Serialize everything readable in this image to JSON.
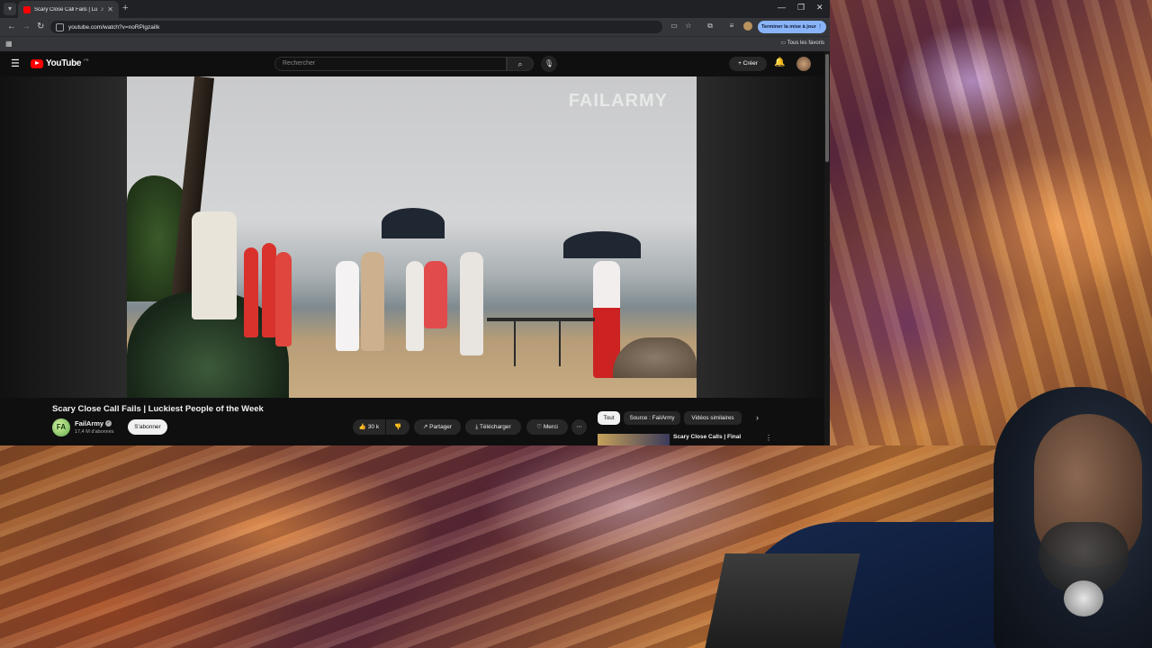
{
  "browser": {
    "tab_title": "Scary Close Call Fails | Lucki",
    "url": "youtube.com/watch?v=noRPigzaiIk",
    "update_button": "Terminer la mise à jour",
    "bookmarks_folder": "Tous les favoris"
  },
  "youtube": {
    "logo_text": "YouTube",
    "logo_sup": "FR",
    "search_placeholder": "Rechercher",
    "create_label": "Créer",
    "watermark": "FAILARMY",
    "video_title": "Scary Close Call Fails | Luckiest People of the Week",
    "channel": {
      "name": "FailArmy",
      "subscribers": "17,4 M d'abonnés",
      "avatar_letter": "FA"
    },
    "subscribe_label": "S'abonner",
    "actions": {
      "likes": "30 k",
      "share": "Partager",
      "download": "Télécharger",
      "thanks": "Merci"
    },
    "chips": [
      "Tout",
      "Source : FailArmy",
      "Vidéos similaires"
    ],
    "recommendation": {
      "title": "Scary Close Calls | Final"
    }
  },
  "colors": {
    "youtube_red": "#ff0000",
    "yt_background": "#0f0f0f",
    "update_button_bg": "#8ab4f8"
  },
  "icons": [
    "hamburger-icon",
    "search-icon",
    "mic-icon",
    "bell-icon",
    "like-icon",
    "dislike-icon",
    "share-icon",
    "download-icon",
    "thanks-icon",
    "more-icon",
    "chevron-right-icon"
  ]
}
